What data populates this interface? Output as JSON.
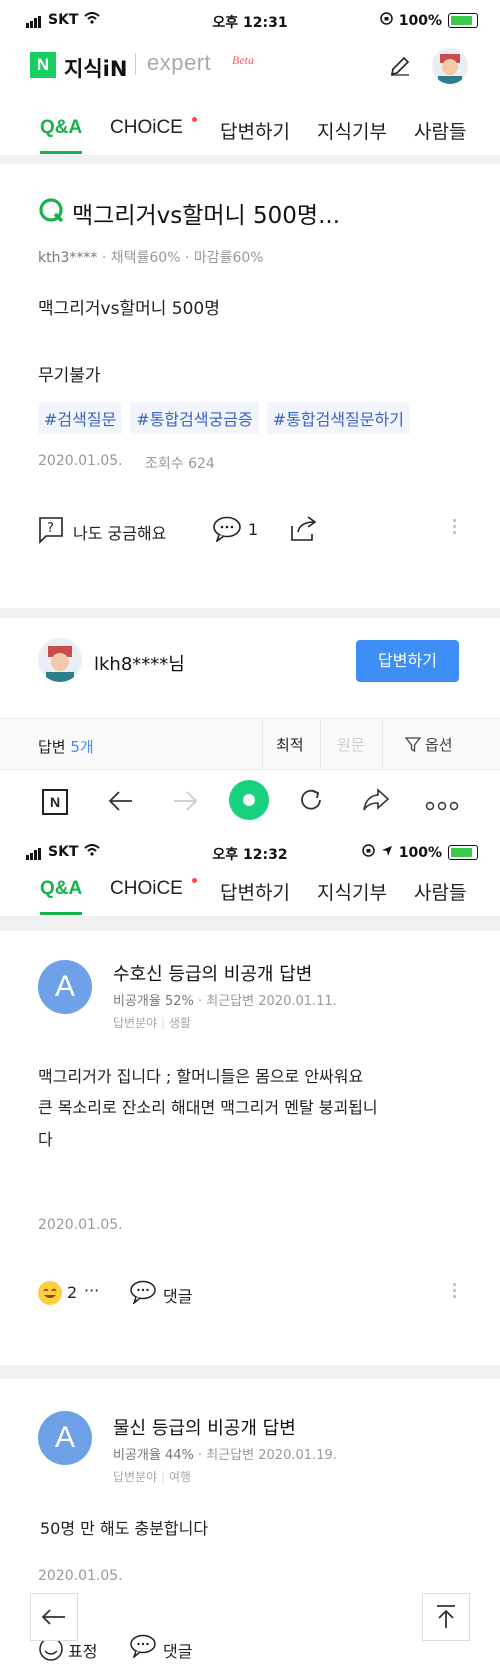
{
  "status1": {
    "carrier": "SKT",
    "time": "오후 12:31",
    "battery": "100%"
  },
  "status2": {
    "carrier": "SKT",
    "time": "오후 12:32",
    "battery": "100%"
  },
  "header": {
    "logo_n": "N",
    "logo_text": "지식iN",
    "expert": "expert",
    "beta": "Beta"
  },
  "tabs": [
    "Q&A",
    "CHOiCE",
    "답변하기",
    "지식기부",
    "사람들"
  ],
  "question": {
    "title": "맥그리거vs할머니 500명...",
    "author": "kth3****",
    "meta": "· 채택률60% · 마감률60%",
    "body1": "맥그리거vs할머니 500명",
    "body2": "무기불가",
    "hashtags": [
      "#검색질문",
      "#통합검색궁금증",
      "#통합검색질문하기"
    ],
    "date": "2020.01.05.",
    "views": "조회수 624",
    "curious": "나도 궁금해요",
    "comments": "1"
  },
  "answer_prompt": {
    "user": "lkh8****님",
    "button": "답변하기"
  },
  "answers_bar": {
    "label": "답변",
    "count": "5개",
    "sort_best": "최적",
    "sort_orig": "원문",
    "options": "옵션"
  },
  "browser": {
    "n": "N"
  },
  "answer1": {
    "avatar": "A",
    "title": "수호신 등급의 비공개 답변",
    "rate": "비공개율 52%",
    "recent": "· 최근답변 2020.01.11.",
    "field_label": "답변분야",
    "field": "생활",
    "body1": "맥그리거가 집니다 ; 할머니들은 몸으로 안싸워요",
    "body2": "큰 목소리로 잔소리 해대면 맥그리거 멘탈 붕괴됩니",
    "body3": "다",
    "date": "2020.01.05.",
    "reactions": "2",
    "more": "···",
    "comment": "댓글"
  },
  "answer2": {
    "avatar": "A",
    "title": "물신 등급의 비공개 답변",
    "rate": "비공개율 44%",
    "recent": "· 최근답변 2020.01.19.",
    "field_label": "답변분야",
    "field": "여행",
    "body": "50명 만 해도 충분합니다",
    "date": "2020.01.05.",
    "reaction": "표정",
    "comment": "댓글"
  }
}
